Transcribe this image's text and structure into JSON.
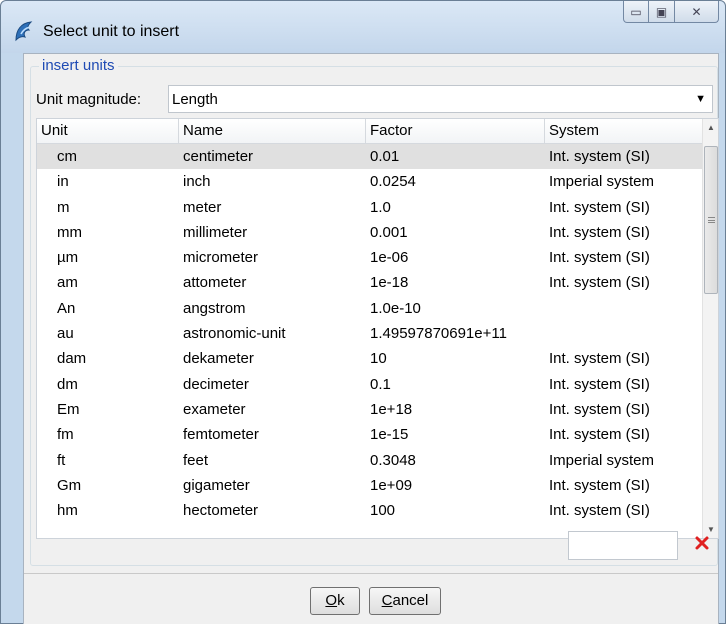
{
  "window": {
    "title": "Select unit to insert",
    "controls": {
      "minimize": "▭",
      "maximize": "▣",
      "close": "✕"
    }
  },
  "group": {
    "legend": "insert units",
    "magnitude_label": "Unit magnitude:",
    "magnitude_value": "Length"
  },
  "table": {
    "headers": [
      "Unit",
      "Name",
      "Factor",
      "System"
    ],
    "rows": [
      {
        "unit": "cm",
        "name": "centimeter",
        "factor": "0.01",
        "system": "Int. system (SI)",
        "selected": true
      },
      {
        "unit": "in",
        "name": "inch",
        "factor": "0.0254",
        "system": "Imperial system"
      },
      {
        "unit": "m",
        "name": "meter",
        "factor": "1.0",
        "system": "Int. system (SI)"
      },
      {
        "unit": "mm",
        "name": "millimeter",
        "factor": "0.001",
        "system": "Int. system (SI)"
      },
      {
        "unit": "µm",
        "name": "micrometer",
        "factor": "1e-06",
        "system": "Int. system (SI)"
      },
      {
        "unit": "am",
        "name": "attometer",
        "factor": "1e-18",
        "system": "Int. system (SI)"
      },
      {
        "unit": "An",
        "name": "angstrom",
        "factor": "1.0e-10",
        "system": ""
      },
      {
        "unit": "au",
        "name": "astronomic-unit",
        "factor": "1.49597870691e+11",
        "system": ""
      },
      {
        "unit": "dam",
        "name": "dekameter",
        "factor": "10",
        "system": "Int. system (SI)"
      },
      {
        "unit": "dm",
        "name": "decimeter",
        "factor": "0.1",
        "system": "Int. system (SI)"
      },
      {
        "unit": "Em",
        "name": "exameter",
        "factor": "1e+18",
        "system": "Int. system (SI)"
      },
      {
        "unit": "fm",
        "name": "femtometer",
        "factor": "1e-15",
        "system": "Int. system (SI)"
      },
      {
        "unit": "ft",
        "name": "feet",
        "factor": "0.3048",
        "system": "Imperial system"
      },
      {
        "unit": "Gm",
        "name": "gigameter",
        "factor": "1e+09",
        "system": "Int. system (SI)"
      },
      {
        "unit": "hm",
        "name": "hectometer",
        "factor": "100",
        "system": "Int. system (SI)"
      }
    ]
  },
  "filter": {
    "value": "",
    "clear_icon": "red-x-icon",
    "clear_color": "#e02020"
  },
  "buttons": {
    "ok_mnemonic": "O",
    "ok_rest": "k",
    "cancel_mnemonic": "C",
    "cancel_rest": "ancel"
  },
  "colors": {
    "legend": "#1f4bb4",
    "selected_row": "#e0e0e0",
    "title_bar": "#c3d6eb"
  }
}
